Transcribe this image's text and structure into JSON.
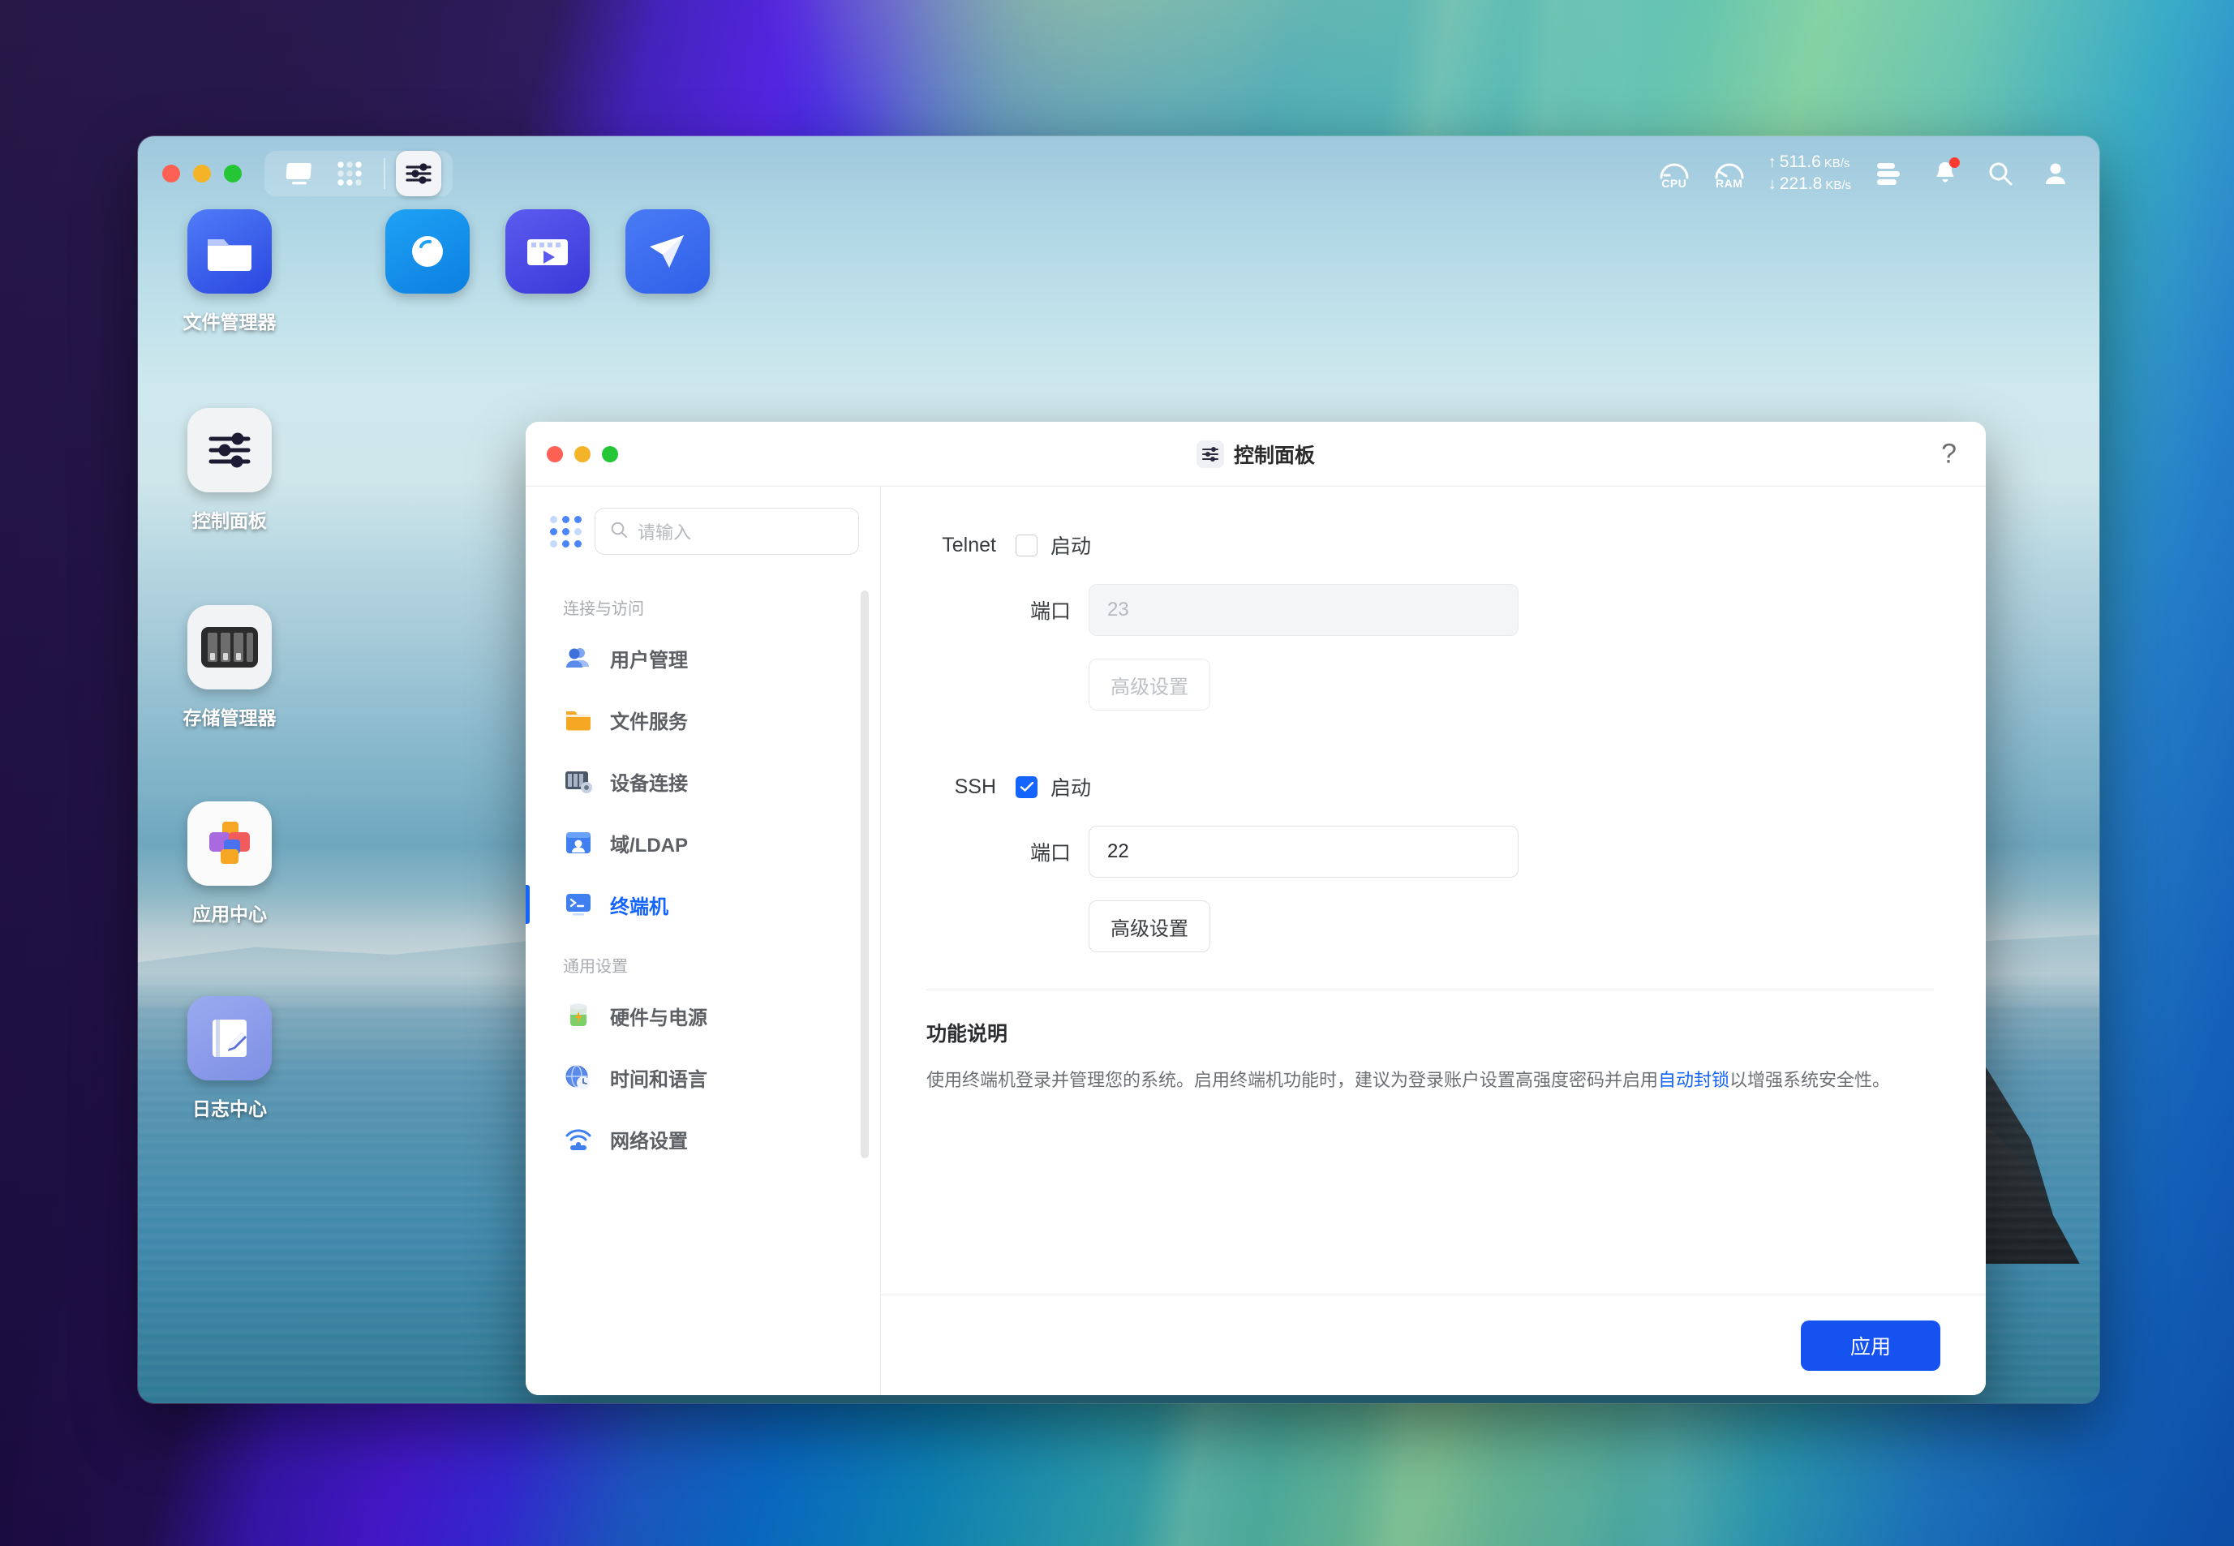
{
  "desktop": {
    "icons": [
      {
        "label": "文件管理器",
        "icon": "folder-icon"
      },
      {
        "label": "控制面板",
        "icon": "sliders-icon"
      },
      {
        "label": "存储管理器",
        "icon": "disk-array-icon"
      },
      {
        "label": "应用中心",
        "icon": "app-center-icon"
      },
      {
        "label": "日志中心",
        "icon": "log-center-icon"
      }
    ],
    "background_icons": [
      {
        "icon": "download-icon"
      },
      {
        "icon": "video-player-icon"
      },
      {
        "icon": "bird-mail-icon"
      }
    ]
  },
  "window": {
    "traffic_lights": [
      "close",
      "minimize",
      "maximize"
    ],
    "toolbar": [
      {
        "name": "display-icon",
        "label": ""
      },
      {
        "name": "apps-grid-icon",
        "label": ""
      },
      {
        "name": "control-panel-icon",
        "label": ""
      }
    ],
    "status": {
      "cpu_label": "CPU",
      "ram_label": "RAM",
      "upload_arrow": "↑",
      "upload_value": "511.6",
      "upload_unit": "KB/s",
      "download_arrow": "↓",
      "download_value": "221.8",
      "download_unit": "KB/s",
      "icons": [
        "task-list-icon",
        "bell-icon",
        "search-icon",
        "user-icon"
      ],
      "notification_badge": true
    }
  },
  "dialog": {
    "title": "控制面板",
    "title_icon": "sliders-icon",
    "help_glyph": "?",
    "sidebar": {
      "apps_grid_icon": "grid-dots-icon",
      "search_placeholder": "请输入",
      "search_value": "",
      "search_icon": "search-icon",
      "groups": [
        {
          "title": "连接与访问",
          "items": [
            {
              "label": "用户管理",
              "icon": "users-icon",
              "active": false
            },
            {
              "label": "文件服务",
              "icon": "folder-orange-icon",
              "active": false
            },
            {
              "label": "设备连接",
              "icon": "device-link-icon",
              "active": false
            },
            {
              "label": "域/LDAP",
              "icon": "ldap-icon",
              "active": false
            },
            {
              "label": "终端机",
              "icon": "terminal-icon",
              "active": true
            }
          ]
        },
        {
          "title": "通用设置",
          "items": [
            {
              "label": "硬件与电源",
              "icon": "battery-icon",
              "active": false
            },
            {
              "label": "时间和语言",
              "icon": "clock-globe-icon",
              "active": false
            },
            {
              "label": "网络设置",
              "icon": "wifi-icon",
              "active": false
            }
          ]
        }
      ]
    },
    "main": {
      "services": [
        {
          "name": "Telnet",
          "enable_label": "启动",
          "enabled": false,
          "port_label": "端口",
          "port_value": "23",
          "port_disabled": true,
          "advanced_label": "高级设置",
          "advanced_disabled": true
        },
        {
          "name": "SSH",
          "enable_label": "启动",
          "enabled": true,
          "port_label": "端口",
          "port_value": "22",
          "port_disabled": false,
          "advanced_label": "高级设置",
          "advanced_disabled": false
        }
      ],
      "description": {
        "title": "功能说明",
        "text_before": "使用终端机登录并管理您的系统。启用终端机功能时，建议为登录账户设置高强度密码并启用",
        "link": "自动封锁",
        "text_after": "以增强系统安全性。"
      }
    },
    "footer": {
      "apply_label": "应用"
    }
  }
}
